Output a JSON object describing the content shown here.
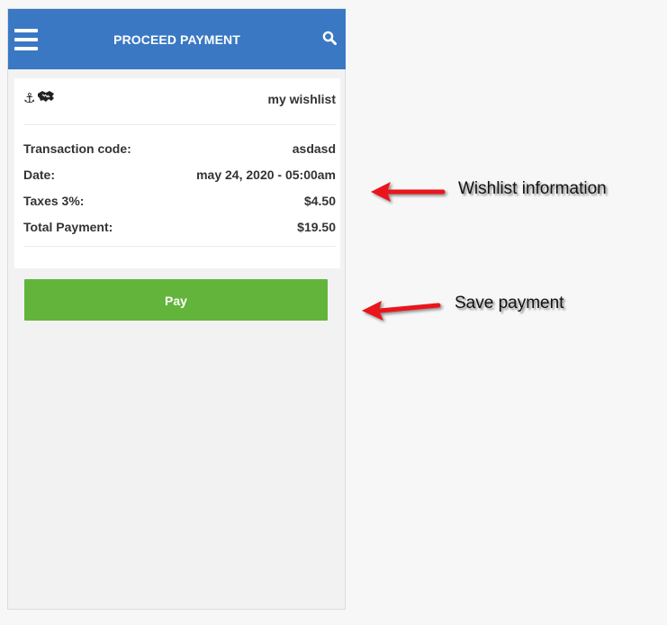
{
  "header": {
    "title": "PROCEED PAYMENT",
    "menu_icon": "hamburger-icon",
    "search_icon": "search-icon",
    "background_color": "#3a78c3"
  },
  "wishlist": {
    "icons": [
      "anchor-icon",
      "handshake-icon"
    ],
    "name": "my wishlist",
    "rows": [
      {
        "label": "Transaction code:",
        "value": "asdasd"
      },
      {
        "label": "Date:",
        "value": "may 24, 2020 - 05:00am"
      },
      {
        "label": "Taxes 3%:",
        "value": "$4.50"
      },
      {
        "label": "Total Payment:",
        "value": "$19.50"
      }
    ]
  },
  "pay_button": {
    "label": "Pay",
    "color": "#62b43a"
  },
  "annotations": {
    "wishlist_info": "Wishlist information",
    "save_payment": "Save payment",
    "arrow_color": "#e8141a"
  }
}
